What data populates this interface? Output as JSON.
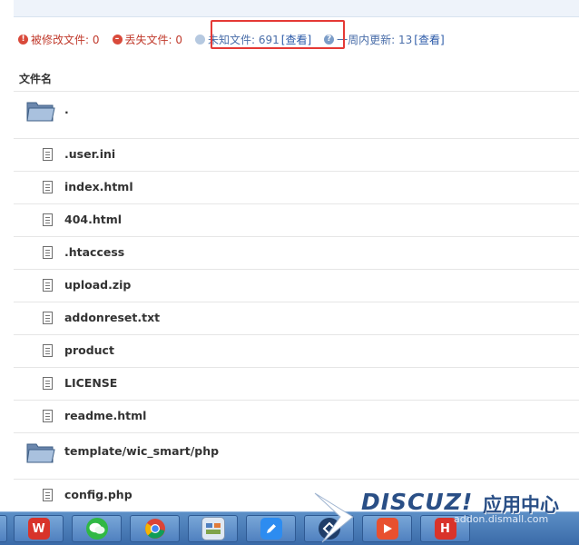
{
  "summary": {
    "modified_label": "被修改文件: 0",
    "missing_label": "丢失文件: 0",
    "unknown_label": "未知文件: 691",
    "unknown_view": "[查看]",
    "weekly_label": "一周内更新: 13",
    "weekly_view": "[查看]"
  },
  "table": {
    "header": "文件名",
    "rows": [
      {
        "name": ".",
        "type": "folder"
      },
      {
        "name": ".user.ini",
        "type": "file"
      },
      {
        "name": "index.html",
        "type": "file"
      },
      {
        "name": "404.html",
        "type": "file"
      },
      {
        "name": ".htaccess",
        "type": "file"
      },
      {
        "name": "upload.zip",
        "type": "file"
      },
      {
        "name": "addonreset.txt",
        "type": "file"
      },
      {
        "name": "product",
        "type": "file"
      },
      {
        "name": "LICENSE",
        "type": "file"
      },
      {
        "name": "readme.html",
        "type": "file"
      },
      {
        "name": "template/wic_smart/php",
        "type": "folder"
      },
      {
        "name": "config.php",
        "type": "file"
      }
    ]
  },
  "taskbar": {
    "apps": [
      {
        "icon": "wps-office-icon"
      },
      {
        "icon": "wechat-icon"
      },
      {
        "icon": "chrome-icon"
      },
      {
        "icon": "control-panel-icon"
      },
      {
        "icon": "pen-editor-icon"
      },
      {
        "icon": "network-tool-icon"
      },
      {
        "icon": "media-player-icon"
      },
      {
        "icon": "h-app-icon"
      }
    ]
  },
  "watermark": {
    "logo": "DISCUZ!",
    "cn": "应用中心",
    "url": "addon.dismall.com"
  },
  "colors": {
    "accent": "#2b5aa8",
    "highlight_box": "#e53935",
    "taskbar": "#3a6aa8"
  }
}
